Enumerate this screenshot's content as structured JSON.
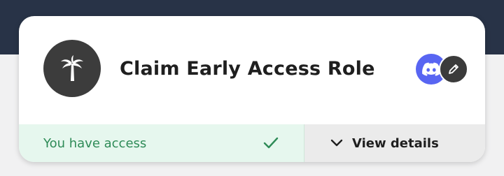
{
  "card": {
    "title": "Claim Early Access Role",
    "main_icon": "palm-tree-icon",
    "badges": {
      "platform_icon": "discord-icon",
      "edit_icon": "pencil-icon"
    }
  },
  "footer": {
    "access_label": "You have access",
    "access_icon": "checkmark-icon",
    "details_label": "View details",
    "details_icon": "chevron-down-icon"
  },
  "colors": {
    "header_band": "#283347",
    "discord": "#5865f2",
    "access_bg": "#e6f7ee",
    "access_text": "#2e8b57",
    "details_bg": "#ebebeb"
  }
}
